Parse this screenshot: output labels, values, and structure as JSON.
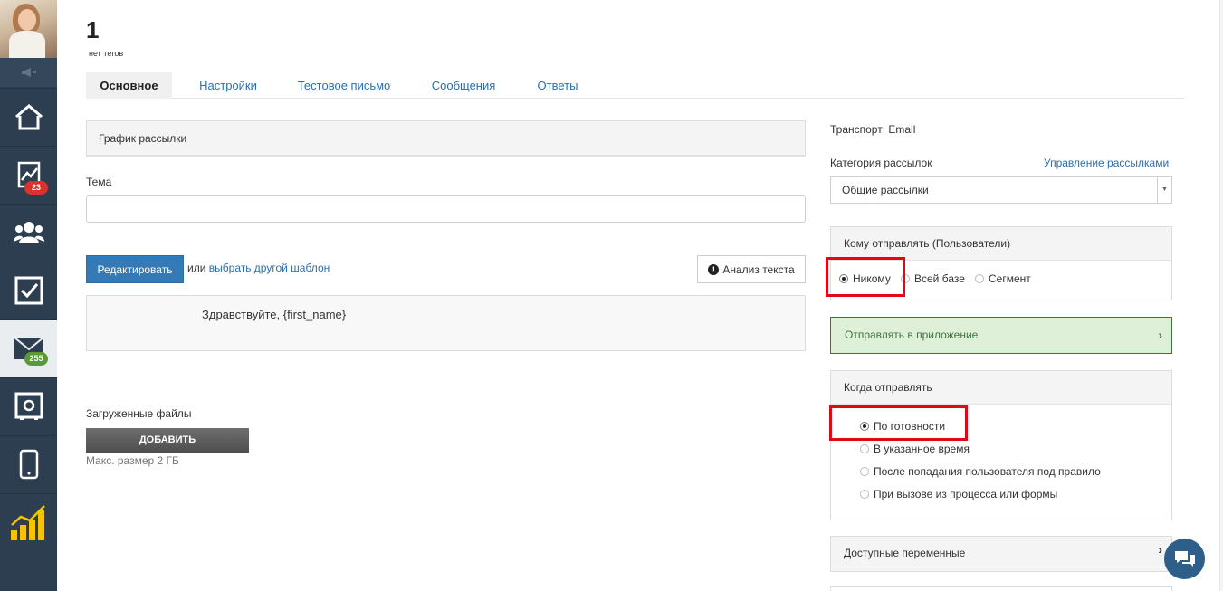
{
  "header": {
    "title": "1",
    "tags": "нет тегов"
  },
  "tabs": [
    {
      "label": "Основное"
    },
    {
      "label": "Настройки"
    },
    {
      "label": "Тестовое письмо"
    },
    {
      "label": "Сообщения"
    },
    {
      "label": "Ответы"
    }
  ],
  "sidebar": {
    "items": [
      {
        "icon": "home-icon"
      },
      {
        "icon": "analytics-icon",
        "badge": "23"
      },
      {
        "icon": "users-icon"
      },
      {
        "icon": "tasks-icon"
      },
      {
        "icon": "mail-icon",
        "badge": "255"
      },
      {
        "icon": "safe-icon"
      },
      {
        "icon": "mobile-icon"
      },
      {
        "icon": "bar-chart-icon"
      }
    ]
  },
  "left": {
    "schedule_label": "График рассылки",
    "subject_label": "Тема",
    "subject_value": "",
    "edit_button": "Редактировать",
    "or_text": "или",
    "choose_template_link": "выбрать другой шаблон",
    "analysis_button": "Анализ текста",
    "preview_text": "Здравствуйте, {first_name}",
    "files_label": "Загруженные файлы",
    "add_button": "ДОБАВИТЬ",
    "max_size": "Макс. размер 2 ГБ"
  },
  "right": {
    "transport": "Транспорт: Email",
    "category_label": "Категория рассылок",
    "manage_link": "Управление рассылками",
    "category_value": "Общие рассылки",
    "recipients_title": "Кому отправлять (Пользователи)",
    "recipients_options": [
      {
        "label": "Никому",
        "checked": true
      },
      {
        "label": "Всей базе",
        "checked": false
      },
      {
        "label": "Сегмент",
        "checked": false
      }
    ],
    "send_to_app": "Отправлять в приложение",
    "when_title": "Когда отправлять",
    "when_options": [
      {
        "label": "По готовности",
        "checked": true
      },
      {
        "label": "В указанное время",
        "checked": false
      },
      {
        "label": "После попадания пользователя под правило",
        "checked": false
      },
      {
        "label": "При вызове из процесса или формы",
        "checked": false
      }
    ],
    "variables_title": "Доступные переменные"
  },
  "colors": {
    "accent": "#337ab7",
    "sidebar": "#2d3e50",
    "highlight": "#e30613",
    "success_bg": "#dff0d8"
  }
}
